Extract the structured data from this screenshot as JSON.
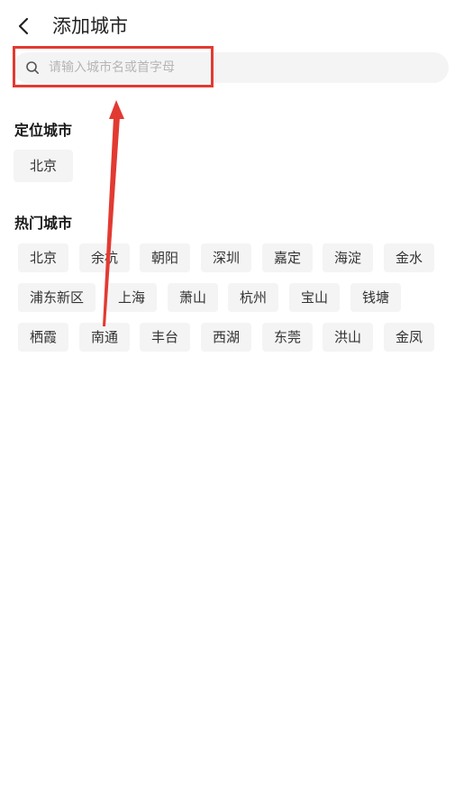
{
  "header": {
    "title": "添加城市",
    "back_icon": "chevron-left-icon"
  },
  "search": {
    "placeholder": "请输入城市名或首字母",
    "value": "",
    "icon": "search-icon"
  },
  "located": {
    "title": "定位城市",
    "cities": [
      "北京"
    ]
  },
  "hot": {
    "title": "热门城市",
    "cities": [
      "北京",
      "余杭",
      "朝阳",
      "深圳",
      "嘉定",
      "海淀",
      "金水",
      "浦东新区",
      "上海",
      "萧山",
      "杭州",
      "宝山",
      "钱塘",
      "栖霞",
      "南通",
      "丰台",
      "西湖",
      "东莞",
      "洪山",
      "金凤"
    ]
  },
  "annotation": {
    "color": "#e23a32"
  }
}
